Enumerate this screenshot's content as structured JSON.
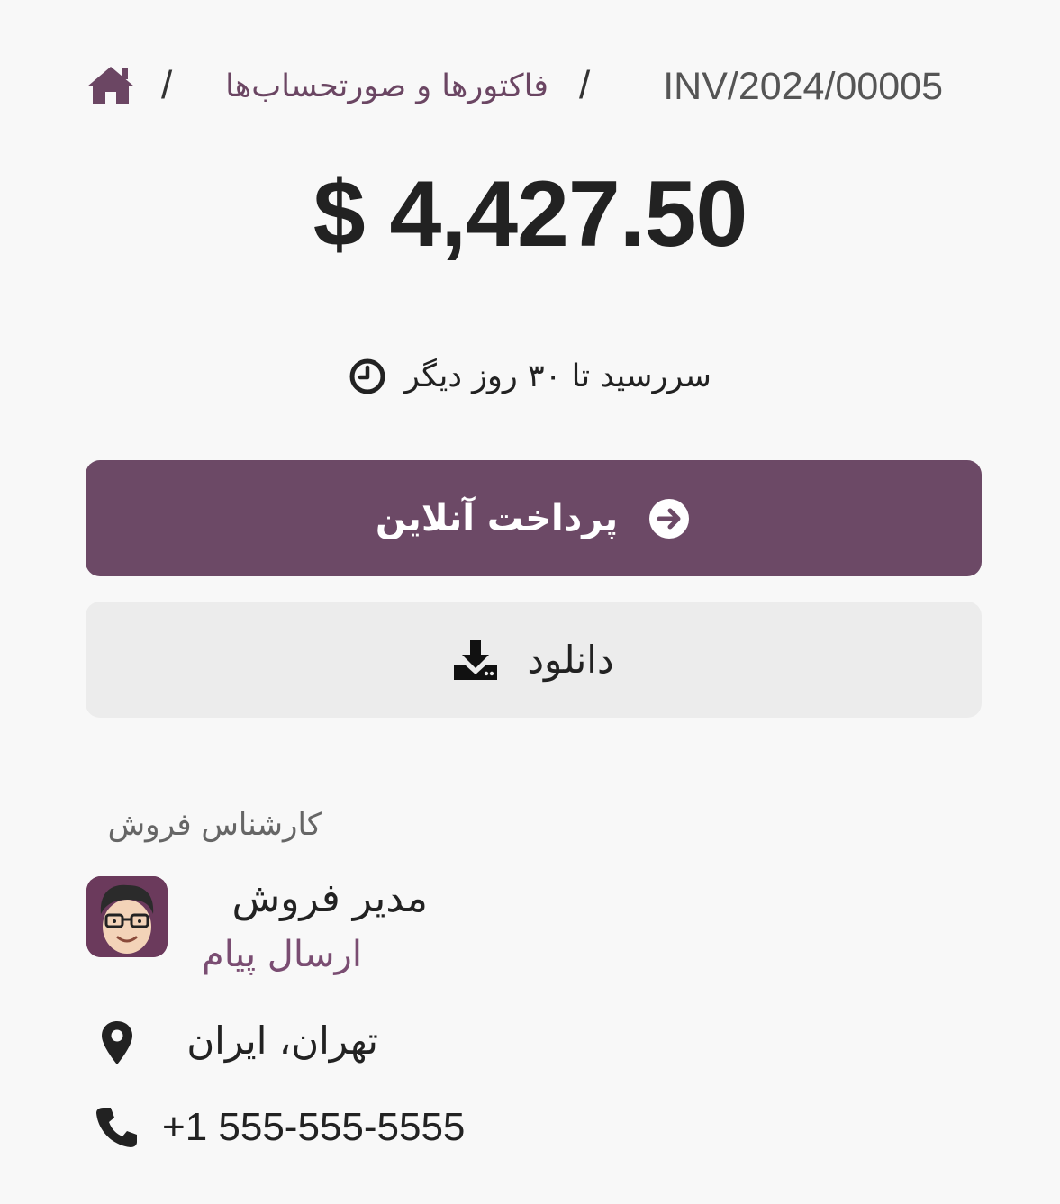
{
  "breadcrumb": {
    "home_icon": "home-icon",
    "separator": "/",
    "link": "فاکتورها و صورتحساب‌ها",
    "current": "INV/2024/00005"
  },
  "invoice": {
    "amount": "$ 4,427.50",
    "due_text": "سررسید تا ۳۰ روز دیگر",
    "due_icon": "clock-icon"
  },
  "actions": {
    "pay_label": "پرداخت آنلاین",
    "pay_icon": "arrow-circle-right-icon",
    "download_label": "دانلود",
    "download_icon": "download-icon"
  },
  "salesperson": {
    "section_label": "کارشناس فروش",
    "name": "مدیر فروش",
    "send_message": "ارسال پیام",
    "avatar_icon": "avatar"
  },
  "contact": {
    "address": "تهران، ایران",
    "address_icon": "map-marker-icon",
    "phone": "+1 555-555-5555",
    "phone_icon": "phone-icon"
  },
  "colors": {
    "brand": "#6c4966",
    "link": "#6b4663",
    "secondary_button": "#ececec"
  }
}
